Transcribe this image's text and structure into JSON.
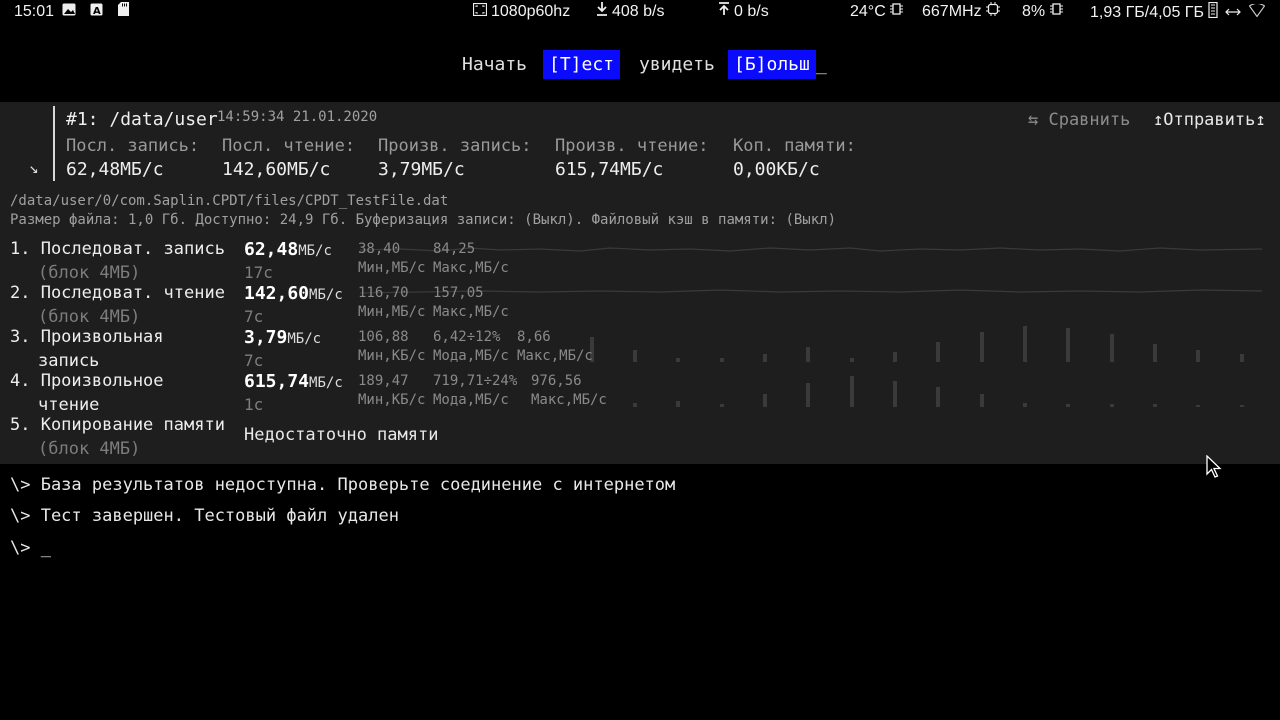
{
  "status_bar": {
    "time": "15:01",
    "left_icons": [
      "image-icon",
      "font-icon",
      "sdcard-icon"
    ],
    "resolution": "1080p60hz",
    "download": "408 b/s",
    "upload": "0 b/s",
    "temperature": "24°C",
    "cpu_freq": "667MHz",
    "cpu_load": "8%",
    "memory": "1,93 ГБ/4,05 ГБ"
  },
  "menu": {
    "items": [
      {
        "label": "Начать",
        "selected": false
      },
      {
        "label": "[Т]ест",
        "selected": true
      },
      {
        "label": "увидеть",
        "selected": false
      },
      {
        "label": "[Б]ольш",
        "selected": true
      }
    ],
    "cursor": "_"
  },
  "result": {
    "number": "#1:",
    "path_short": "/data/user",
    "datetime": "14:59:34 21.01.2020",
    "compare_label": "⇆ Сравнить",
    "send_label": "↥Отправить↥",
    "summary": [
      {
        "label": "Посл. запись:",
        "value": "62,48МБ/с"
      },
      {
        "label": "Посл. чтение:",
        "value": "142,60МБ/с"
      },
      {
        "label": "Произв. запись:",
        "value": "3,79МБ/с"
      },
      {
        "label": "Произв. чтение:",
        "value": "615,74МБ/с"
      },
      {
        "label": "Коп. памяти:",
        "value": "0,00КБ/с"
      }
    ],
    "file_path": "/data/user/0/com.Saplin.CPDT/files/CPDT_TestFile.dat",
    "file_info": "Размер файла: 1,0 Гб. Доступно: 24,9 Гб. Буферизация записи: (Выкл). Файловый кэш в памяти: (Выкл)",
    "tests": [
      {
        "label": "1. Последоват. запись",
        "sub": "(блок 4МБ)",
        "value": "62,48",
        "unit": "МБ/с",
        "time": "17с",
        "stats": [
          {
            "num": "38,40",
            "lbl": "Мин,МБ/с"
          },
          {
            "num": "84,25",
            "lbl": "Макс,МБ/с"
          }
        ]
      },
      {
        "label": "2. Последоват. чтение",
        "sub": "(блок 4МБ)",
        "value": "142,60",
        "unit": "МБ/с",
        "time": "7с",
        "stats": [
          {
            "num": "116,70",
            "lbl": "Мин,МБ/с"
          },
          {
            "num": "157,05",
            "lbl": "Макс,МБ/с"
          }
        ]
      },
      {
        "label": "3. Произвольная",
        "sub": "запись",
        "value": "3,79",
        "unit": "МБ/с",
        "time": "7с",
        "stats": [
          {
            "num": "106,88",
            "lbl": "Мин,КБ/с"
          },
          {
            "num": "6,42÷12%",
            "lbl": "Мода,МБ/с"
          },
          {
            "num": "8,66",
            "lbl": "Макс,МБ/с"
          }
        ]
      },
      {
        "label": "4. Произвольное",
        "sub": "чтение",
        "value": "615,74",
        "unit": "МБ/с",
        "time": "1с",
        "stats": [
          {
            "num": "189,47",
            "lbl": "Мин,КБ/с"
          },
          {
            "num": "719,71÷24%",
            "lbl": "Мода,МБ/с"
          },
          {
            "num": "976,56",
            "lbl": "Макс,МБ/с"
          }
        ]
      },
      {
        "label": "5. Копирование памяти",
        "sub": "(блок 4МБ)",
        "message": "Недостаточно памяти"
      }
    ]
  },
  "console": {
    "lines": [
      "\\> База результатов недоступна. Проверьте соединение с интернетом",
      "\\> Тест завершен. Тестовый файл удален",
      "\\> _"
    ]
  }
}
